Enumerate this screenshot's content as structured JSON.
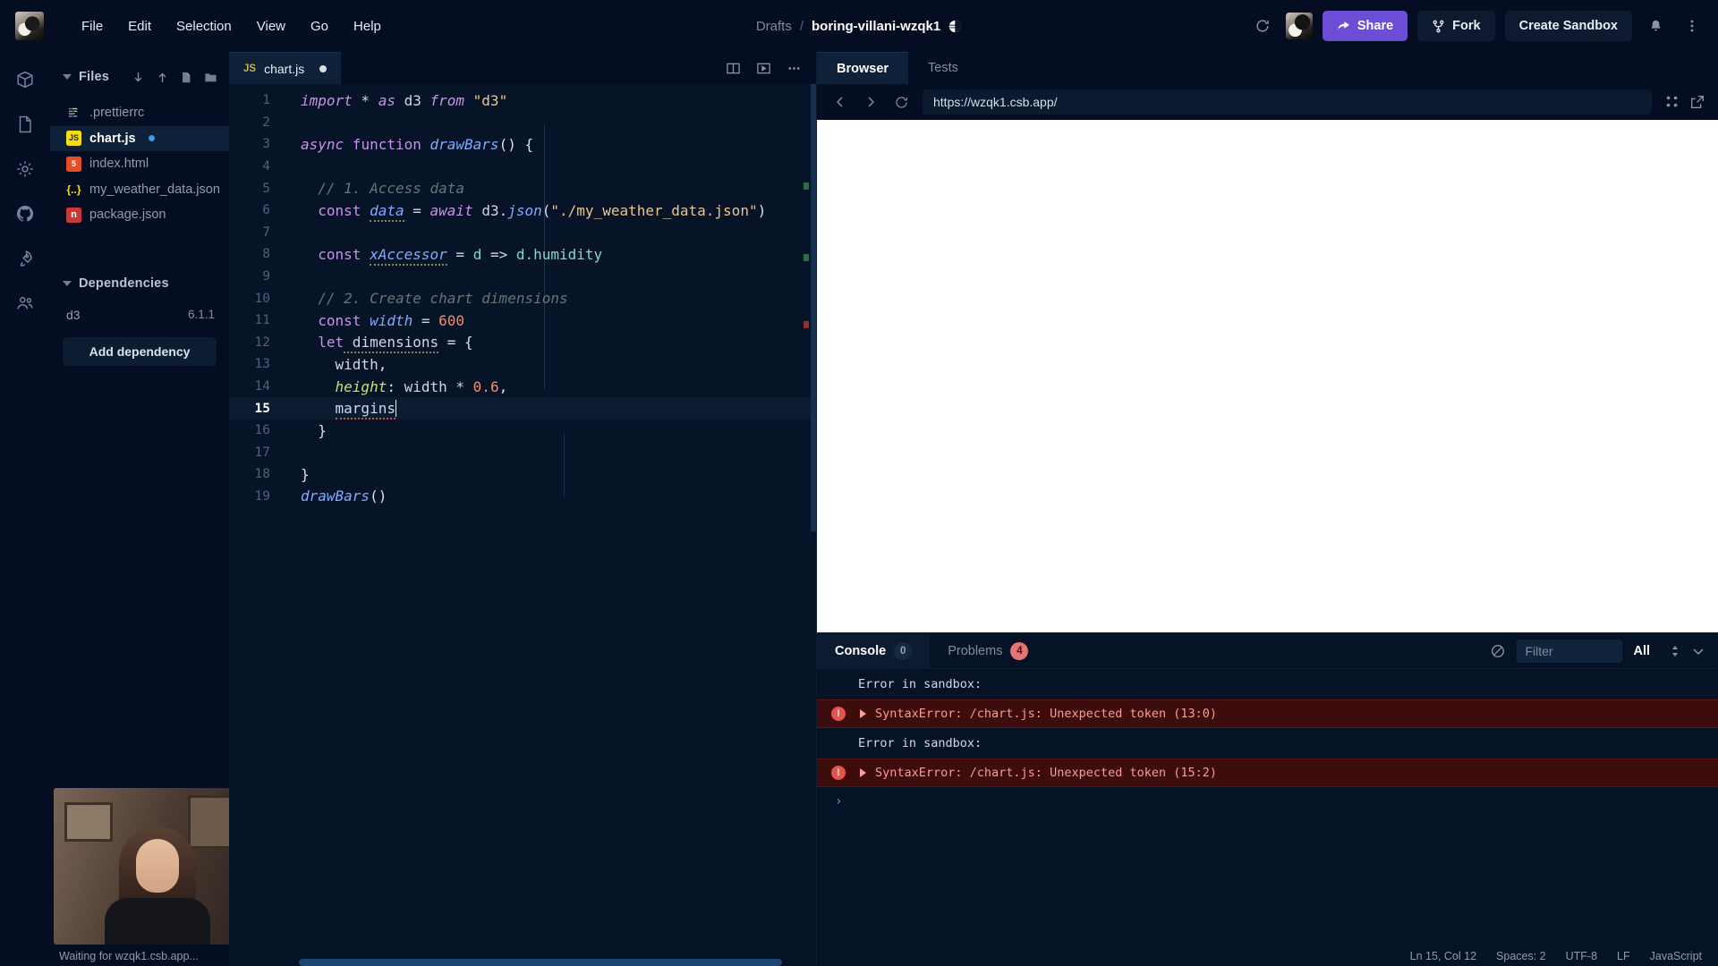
{
  "menubar": {
    "items": [
      "File",
      "Edit",
      "Selection",
      "View",
      "Go",
      "Help"
    ],
    "logo_icon": "dog-avatar"
  },
  "breadcrumb": {
    "workspace": "Drafts",
    "separator": "/",
    "sandbox_name": "boring-villani-wzqk1",
    "privacy_icon": "globe-icon"
  },
  "header_actions": {
    "refresh_icon": "refresh-icon",
    "avatar": "user-avatar",
    "share_label": "Share",
    "fork_label": "Fork",
    "create_sandbox_label": "Create Sandbox",
    "notifications_icon": "bell-icon",
    "more_icon": "more-vertical-icon",
    "accent_color": "#6c4ed6"
  },
  "activitybar": {
    "items": [
      {
        "name": "sandbox-explorer",
        "icon": "box-icon"
      },
      {
        "name": "files",
        "icon": "file-icon"
      },
      {
        "name": "settings",
        "icon": "gear-icon"
      },
      {
        "name": "github",
        "icon": "github-icon"
      },
      {
        "name": "deploy",
        "icon": "rocket-icon"
      },
      {
        "name": "live-collaboration",
        "icon": "people-icon"
      }
    ]
  },
  "sidebar": {
    "files_title": "Files",
    "actions": [
      "download-icon",
      "upload-icon",
      "new-file-icon",
      "new-folder-icon"
    ],
    "files": [
      {
        "name": ".prettierrc",
        "icon": "prettier-icon",
        "icon_glyph": "P",
        "active": false,
        "dirty": false
      },
      {
        "name": "chart.js",
        "icon": "js-icon",
        "icon_glyph": "JS",
        "active": true,
        "dirty": true
      },
      {
        "name": "index.html",
        "icon": "html-icon",
        "icon_glyph": "5",
        "active": false,
        "dirty": false
      },
      {
        "name": "my_weather_data.json",
        "icon": "json-icon",
        "icon_glyph": "{..}",
        "active": false,
        "dirty": false
      },
      {
        "name": "package.json",
        "icon": "npm-icon",
        "icon_glyph": "n",
        "active": false,
        "dirty": false
      }
    ],
    "dependencies_title": "Dependencies",
    "dependencies": [
      {
        "name": "d3",
        "version": "6.1.1"
      }
    ],
    "add_dependency_label": "Add dependency",
    "loading_status": "Waiting for wzqk1.csb.app..."
  },
  "editor": {
    "tab": {
      "label": "chart.js",
      "icon_glyph": "JS",
      "dirty": true
    },
    "tab_actions": [
      "split-editor-icon",
      "preview-icon",
      "more-horizontal-icon"
    ],
    "lines": [
      {
        "n": 1,
        "active": false
      },
      {
        "n": 2,
        "active": false
      },
      {
        "n": 3,
        "active": false
      },
      {
        "n": 4,
        "active": false
      },
      {
        "n": 5,
        "active": false
      },
      {
        "n": 6,
        "active": false
      },
      {
        "n": 7,
        "active": false
      },
      {
        "n": 8,
        "active": false
      },
      {
        "n": 9,
        "active": false
      },
      {
        "n": 10,
        "active": false
      },
      {
        "n": 11,
        "active": false
      },
      {
        "n": 12,
        "active": false
      },
      {
        "n": 13,
        "active": false
      },
      {
        "n": 14,
        "active": false
      },
      {
        "n": 15,
        "active": true
      },
      {
        "n": 16,
        "active": false
      },
      {
        "n": 17,
        "active": false
      },
      {
        "n": 18,
        "active": false
      },
      {
        "n": 19,
        "active": false
      }
    ],
    "code_text": {
      "l1_import": "import",
      "l1_star": " * ",
      "l1_as": "as",
      "l1_d3": " d3 ",
      "l1_from": "from",
      "l1_module": " \"d3\"",
      "l3_async": "async",
      "l3_function": " function ",
      "l3_name": "drawBars",
      "l3_tail": "() {",
      "l5_comment": "// 1. Access data",
      "l6_const": "const",
      "l6_data": "data",
      "l6_eq": " = ",
      "l6_await": "await",
      "l6_d3": " d3.",
      "l6_json": "json",
      "l6_open": "(",
      "l6_path": "\"./my_weather_data.json\"",
      "l6_close": ")",
      "l8_const": "const",
      "l8_name": "xAccessor",
      "l8_eq": " = ",
      "l8_d": "d",
      "l8_arrow": " => ",
      "l8_expr": "d.humidity",
      "l10_comment": "// 2. Create chart dimensions",
      "l11_const": "const",
      "l11_name": " width",
      "l11_eq": " = ",
      "l11_value": "600",
      "l12_let": "let",
      "l12_name": " dimensions",
      "l12_tail": " = {",
      "l13_width": "width",
      "l13_comma": ",",
      "l14_key": "height",
      "l14_colon": ": ",
      "l14_width": "width",
      "l14_mul": " * ",
      "l14_num": "0.6",
      "l14_comma": ",",
      "l15_margins": "margins",
      "l16_close": "}",
      "l18_close": "}",
      "l19_call": "drawBars",
      "l19_parens": "()"
    }
  },
  "preview": {
    "tabs": [
      {
        "label": "Browser",
        "active": true
      },
      {
        "label": "Tests",
        "active": false
      }
    ],
    "nav": {
      "back_icon": "chevron-left-icon",
      "forward_icon": "chevron-right-icon",
      "reload_icon": "reload-icon"
    },
    "url": "https://wzqk1.csb.app/",
    "right_icons": [
      "responsive-icon",
      "external-link-icon"
    ]
  },
  "console": {
    "tabs": [
      {
        "label": "Console",
        "badge": "0",
        "active": true,
        "badge_error": false
      },
      {
        "label": "Problems",
        "badge": "4",
        "active": false,
        "badge_error": true
      }
    ],
    "clear_icon": "clear-console-icon",
    "filter_placeholder": "Filter",
    "level_label": "All",
    "sort_icon": "sort-icon",
    "collapse_icon": "chevron-down-icon",
    "entries": [
      {
        "type": "plain",
        "text": "Error in sandbox:"
      },
      {
        "type": "error",
        "text": "SyntaxError: /chart.js: Unexpected token (13:0)"
      },
      {
        "type": "plain",
        "text": "Error in sandbox:"
      },
      {
        "type": "error",
        "text": "SyntaxError: /chart.js: Unexpected token (15:2)"
      }
    ],
    "prompt": "›"
  },
  "statusbar": {
    "cursor": "Ln 15, Col 12",
    "spaces": "Spaces: 2",
    "encoding": "UTF-8",
    "eol": "LF",
    "language": "JavaScript"
  }
}
